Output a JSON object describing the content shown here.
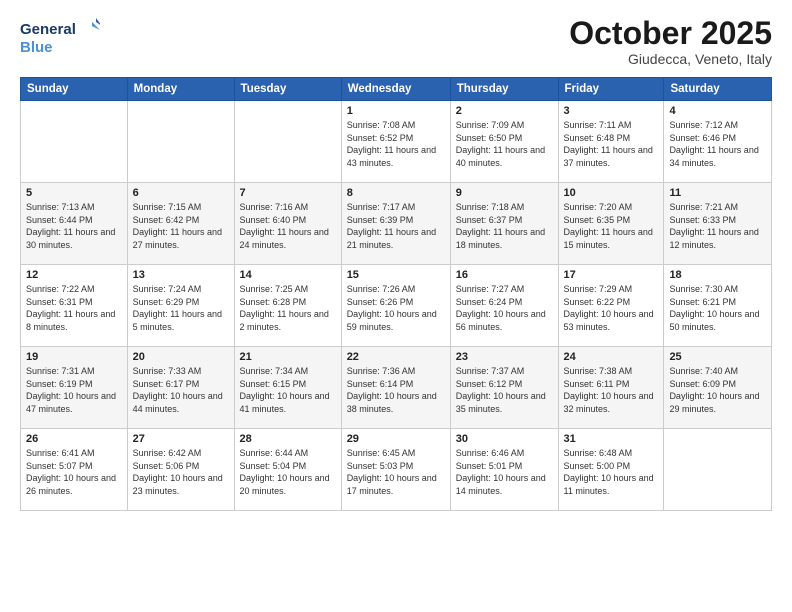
{
  "logo": {
    "line1": "General",
    "line2": "Blue"
  },
  "title": "October 2025",
  "subtitle": "Giudecca, Veneto, Italy",
  "days_of_week": [
    "Sunday",
    "Monday",
    "Tuesday",
    "Wednesday",
    "Thursday",
    "Friday",
    "Saturday"
  ],
  "weeks": [
    [
      {
        "day": "",
        "info": ""
      },
      {
        "day": "",
        "info": ""
      },
      {
        "day": "",
        "info": ""
      },
      {
        "day": "1",
        "info": "Sunrise: 7:08 AM\nSunset: 6:52 PM\nDaylight: 11 hours and 43 minutes."
      },
      {
        "day": "2",
        "info": "Sunrise: 7:09 AM\nSunset: 6:50 PM\nDaylight: 11 hours and 40 minutes."
      },
      {
        "day": "3",
        "info": "Sunrise: 7:11 AM\nSunset: 6:48 PM\nDaylight: 11 hours and 37 minutes."
      },
      {
        "day": "4",
        "info": "Sunrise: 7:12 AM\nSunset: 6:46 PM\nDaylight: 11 hours and 34 minutes."
      }
    ],
    [
      {
        "day": "5",
        "info": "Sunrise: 7:13 AM\nSunset: 6:44 PM\nDaylight: 11 hours and 30 minutes."
      },
      {
        "day": "6",
        "info": "Sunrise: 7:15 AM\nSunset: 6:42 PM\nDaylight: 11 hours and 27 minutes."
      },
      {
        "day": "7",
        "info": "Sunrise: 7:16 AM\nSunset: 6:40 PM\nDaylight: 11 hours and 24 minutes."
      },
      {
        "day": "8",
        "info": "Sunrise: 7:17 AM\nSunset: 6:39 PM\nDaylight: 11 hours and 21 minutes."
      },
      {
        "day": "9",
        "info": "Sunrise: 7:18 AM\nSunset: 6:37 PM\nDaylight: 11 hours and 18 minutes."
      },
      {
        "day": "10",
        "info": "Sunrise: 7:20 AM\nSunset: 6:35 PM\nDaylight: 11 hours and 15 minutes."
      },
      {
        "day": "11",
        "info": "Sunrise: 7:21 AM\nSunset: 6:33 PM\nDaylight: 11 hours and 12 minutes."
      }
    ],
    [
      {
        "day": "12",
        "info": "Sunrise: 7:22 AM\nSunset: 6:31 PM\nDaylight: 11 hours and 8 minutes."
      },
      {
        "day": "13",
        "info": "Sunrise: 7:24 AM\nSunset: 6:29 PM\nDaylight: 11 hours and 5 minutes."
      },
      {
        "day": "14",
        "info": "Sunrise: 7:25 AM\nSunset: 6:28 PM\nDaylight: 11 hours and 2 minutes."
      },
      {
        "day": "15",
        "info": "Sunrise: 7:26 AM\nSunset: 6:26 PM\nDaylight: 10 hours and 59 minutes."
      },
      {
        "day": "16",
        "info": "Sunrise: 7:27 AM\nSunset: 6:24 PM\nDaylight: 10 hours and 56 minutes."
      },
      {
        "day": "17",
        "info": "Sunrise: 7:29 AM\nSunset: 6:22 PM\nDaylight: 10 hours and 53 minutes."
      },
      {
        "day": "18",
        "info": "Sunrise: 7:30 AM\nSunset: 6:21 PM\nDaylight: 10 hours and 50 minutes."
      }
    ],
    [
      {
        "day": "19",
        "info": "Sunrise: 7:31 AM\nSunset: 6:19 PM\nDaylight: 10 hours and 47 minutes."
      },
      {
        "day": "20",
        "info": "Sunrise: 7:33 AM\nSunset: 6:17 PM\nDaylight: 10 hours and 44 minutes."
      },
      {
        "day": "21",
        "info": "Sunrise: 7:34 AM\nSunset: 6:15 PM\nDaylight: 10 hours and 41 minutes."
      },
      {
        "day": "22",
        "info": "Sunrise: 7:36 AM\nSunset: 6:14 PM\nDaylight: 10 hours and 38 minutes."
      },
      {
        "day": "23",
        "info": "Sunrise: 7:37 AM\nSunset: 6:12 PM\nDaylight: 10 hours and 35 minutes."
      },
      {
        "day": "24",
        "info": "Sunrise: 7:38 AM\nSunset: 6:11 PM\nDaylight: 10 hours and 32 minutes."
      },
      {
        "day": "25",
        "info": "Sunrise: 7:40 AM\nSunset: 6:09 PM\nDaylight: 10 hours and 29 minutes."
      }
    ],
    [
      {
        "day": "26",
        "info": "Sunrise: 6:41 AM\nSunset: 5:07 PM\nDaylight: 10 hours and 26 minutes."
      },
      {
        "day": "27",
        "info": "Sunrise: 6:42 AM\nSunset: 5:06 PM\nDaylight: 10 hours and 23 minutes."
      },
      {
        "day": "28",
        "info": "Sunrise: 6:44 AM\nSunset: 5:04 PM\nDaylight: 10 hours and 20 minutes."
      },
      {
        "day": "29",
        "info": "Sunrise: 6:45 AM\nSunset: 5:03 PM\nDaylight: 10 hours and 17 minutes."
      },
      {
        "day": "30",
        "info": "Sunrise: 6:46 AM\nSunset: 5:01 PM\nDaylight: 10 hours and 14 minutes."
      },
      {
        "day": "31",
        "info": "Sunrise: 6:48 AM\nSunset: 5:00 PM\nDaylight: 10 hours and 11 minutes."
      },
      {
        "day": "",
        "info": ""
      }
    ]
  ]
}
